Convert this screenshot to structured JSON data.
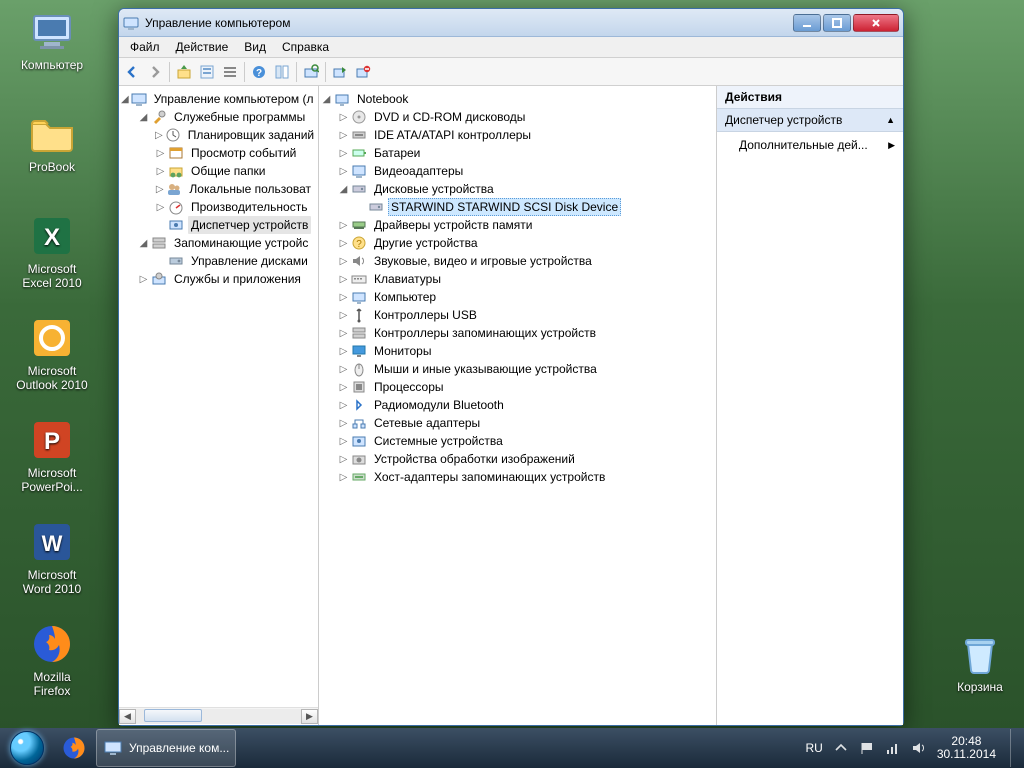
{
  "desktop_icons": [
    {
      "id": "computer",
      "label": "Компьютер"
    },
    {
      "id": "probook",
      "label": "ProBook"
    },
    {
      "id": "excel",
      "label": "Microsoft Excel 2010"
    },
    {
      "id": "outlook",
      "label": "Microsoft Outlook 2010"
    },
    {
      "id": "ppt",
      "label": "Microsoft PowerPoi..."
    },
    {
      "id": "word",
      "label": "Microsoft Word 2010"
    },
    {
      "id": "firefox",
      "label": "Mozilla Firefox"
    },
    {
      "id": "recycle",
      "label": "Корзина"
    }
  ],
  "window": {
    "title": "Управление компьютером",
    "menu": [
      "Файл",
      "Действие",
      "Вид",
      "Справка"
    ],
    "toolbar": [
      "back",
      "forward",
      "up",
      "props",
      "list",
      "refresh",
      "help",
      "show",
      "connect",
      "add",
      "remove"
    ]
  },
  "left_tree": {
    "root": "Управление компьютером (л",
    "groups": [
      {
        "label": "Служебные программы",
        "children": [
          "Планировщик заданий",
          "Просмотр событий",
          "Общие папки",
          "Локальные пользоват",
          "Производительность",
          "Диспетчер устройств"
        ],
        "selected": "Диспетчер устройств"
      },
      {
        "label": "Запоминающие устройс",
        "children": [
          "Управление дисками"
        ]
      },
      {
        "label": "Службы и приложения",
        "children": []
      }
    ]
  },
  "mid_tree": {
    "root": "Notebook",
    "items": [
      "DVD и CD-ROM дисководы",
      "IDE ATA/ATAPI контроллеры",
      "Батареи",
      "Видеоадаптеры",
      {
        "label": "Дисковые устройства",
        "children": [
          "STARWIND STARWIND SCSI Disk Device"
        ],
        "expanded": true,
        "selected_child": 0
      },
      "Драйверы устройств памяти",
      "Другие устройства",
      "Звуковые, видео и игровые устройства",
      "Клавиатуры",
      "Компьютер",
      "Контроллеры USB",
      "Контроллеры запоминающих устройств",
      "Мониторы",
      "Мыши и иные указывающие устройства",
      "Процессоры",
      "Радиомодули Bluetooth",
      "Сетевые адаптеры",
      "Системные устройства",
      "Устройства обработки изображений",
      "Хост-адаптеры запоминающих устройств"
    ]
  },
  "actions": {
    "header": "Действия",
    "section": "Диспетчер устройств",
    "item": "Дополнительные дей..."
  },
  "taskbar": {
    "app_title": "Управление ком...",
    "lang": "RU",
    "time": "20:48",
    "date": "30.11.2014"
  }
}
